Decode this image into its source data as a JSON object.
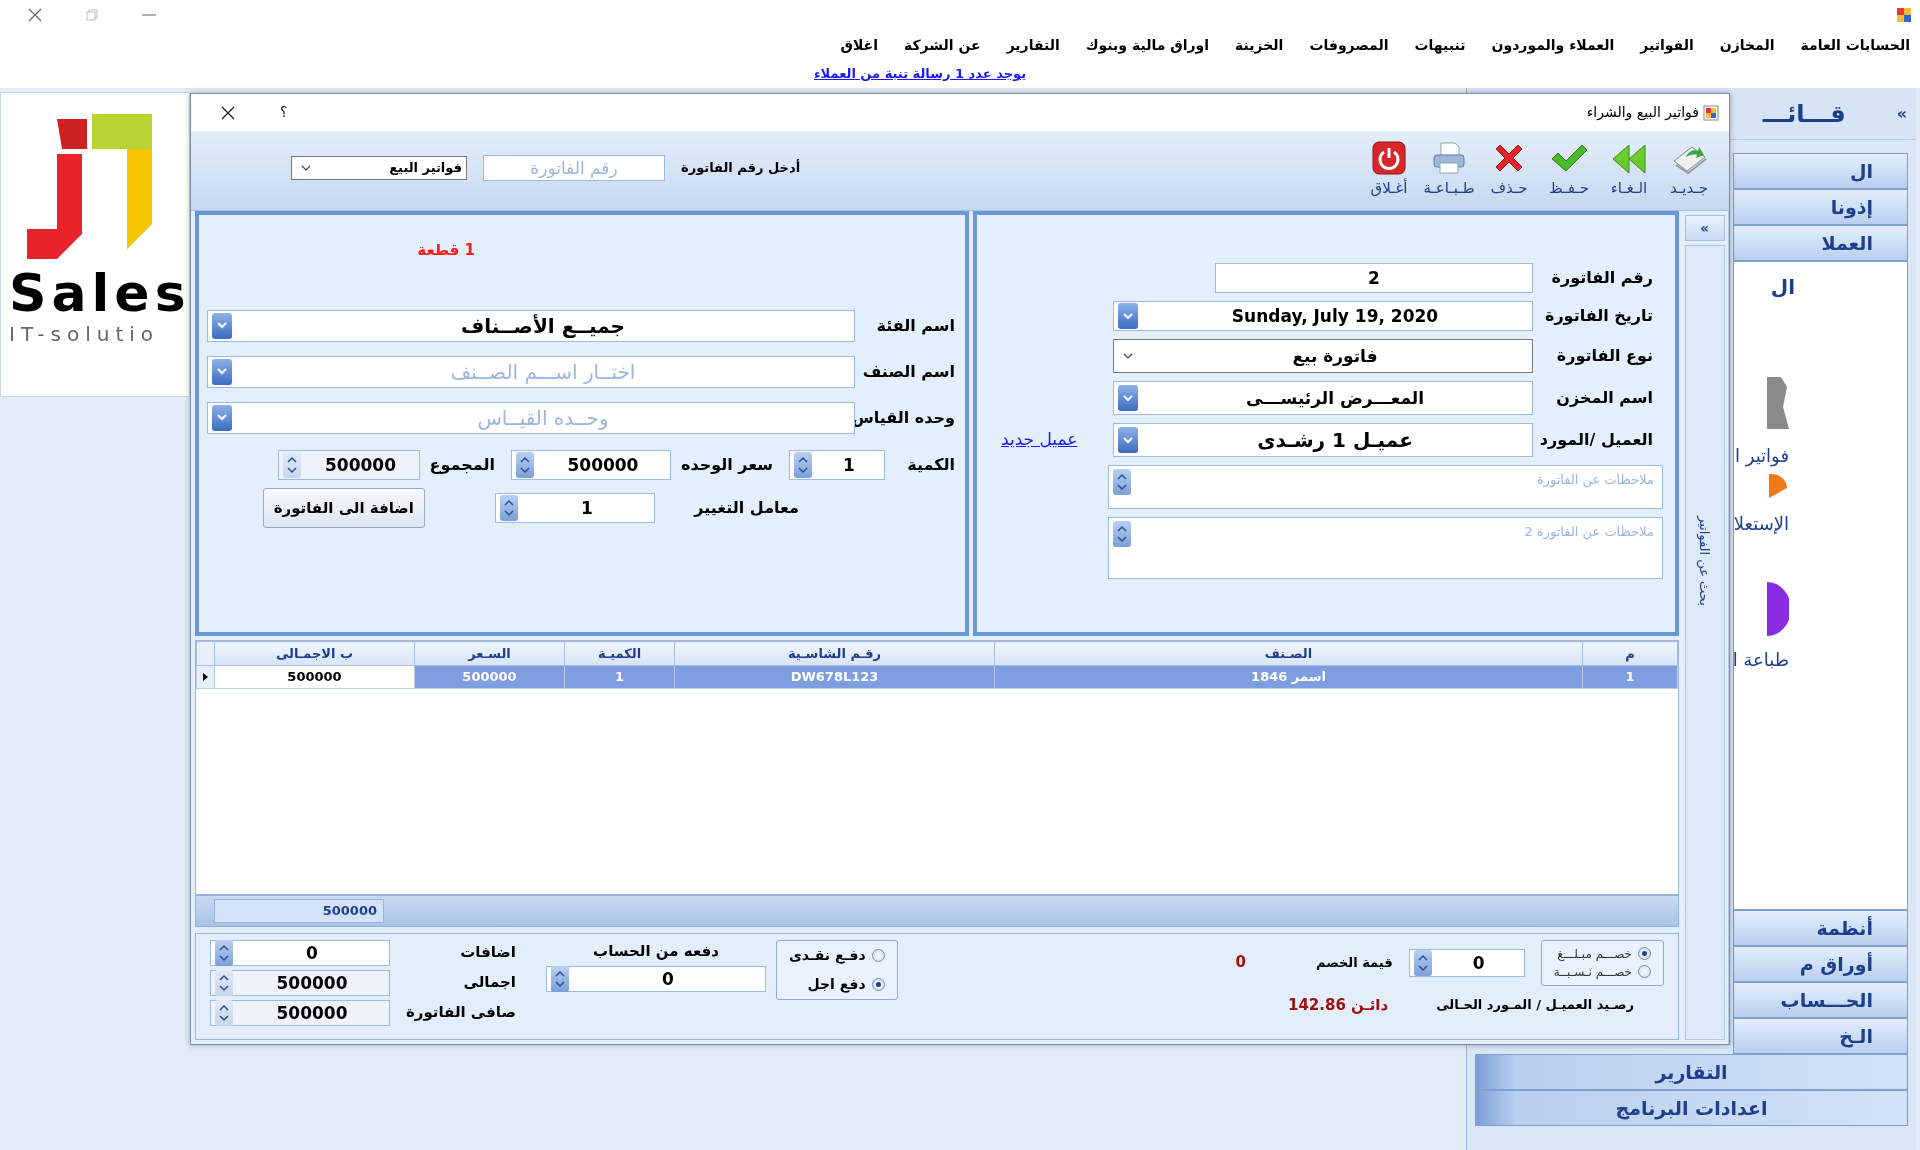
{
  "menu": [
    {
      "label": "الحسابات العامة"
    },
    {
      "label": "المخازن"
    },
    {
      "label": "الفواتير"
    },
    {
      "label": "العملاء والموردون"
    },
    {
      "label": "تنبيهات"
    },
    {
      "label": "المصروفات"
    },
    {
      "label": "الخزينة"
    },
    {
      "label": "اوراق مالية وبنوك"
    },
    {
      "label": "التقارير"
    },
    {
      "label": "عن الشركة"
    },
    {
      "label": "اغلاق"
    }
  ],
  "notice_link": "يوجد عدد 1 رسالة تنبة من العملاء",
  "logo": {
    "name": "Sales",
    "tagline": "IT-solutio"
  },
  "sidebar": {
    "title": "قـــائـــ",
    "collapse": "»",
    "sections_top": [
      "ال",
      "إذونا",
      "العملا"
    ],
    "panel_items": [
      {
        "kind": "header",
        "label": "ال"
      },
      {
        "kind": "figure",
        "label": "فواتير ا"
      },
      {
        "kind": "half-disc",
        "label": "الإستعلا"
      },
      {
        "kind": "disc",
        "label": "طباعة ا"
      }
    ],
    "sections_bottom": [
      "أنظمة",
      "أوراق م",
      "الحـــساب",
      "الـخ",
      "التقارير",
      "اعدادات البرنامج"
    ]
  },
  "dialog": {
    "title": "فواتير البيع والشراء",
    "help": "؟",
    "toolbar": [
      {
        "kind": "new",
        "label": "جـديـد"
      },
      {
        "kind": "cancel",
        "label": "الـغـاء"
      },
      {
        "kind": "save",
        "label": "حـفـظ"
      },
      {
        "kind": "delete",
        "label": "حـذف"
      },
      {
        "kind": "print",
        "label": "طـبـاعـة"
      },
      {
        "kind": "close",
        "label": "أغـلاق"
      }
    ],
    "invoice_lookup": {
      "label": "أدخل رقم الفاتورة",
      "placeholder": "رقم الفاتورة",
      "type_value": "فواتير البيع"
    },
    "invoice_panel": {
      "fields": [
        {
          "kind": "text",
          "label": "رقم الفاتورة",
          "value": "2"
        },
        {
          "kind": "combo",
          "label": "تاريخ الفاتورة",
          "value": "Sunday, July 19, 2020"
        },
        {
          "kind": "select",
          "label": "نوع الفاتورة",
          "value": "فاتورة بيع"
        },
        {
          "kind": "combo",
          "label": "اسم المخزن",
          "value": "المعـــرض الرئيســـى"
        },
        {
          "kind": "combo",
          "label": "العميل /المورد",
          "value": "عميـل 1 رشـدى",
          "link": "عميل جديد"
        }
      ],
      "notes": [
        {
          "placeholder": "ملاحظات عن الفاتورة"
        },
        {
          "placeholder": "ملاحظات عن الفاتورة 2"
        }
      ]
    },
    "item_panel": {
      "stock_note": "1 قطعة",
      "fields": [
        {
          "label": "اسم الفئة",
          "value": "جميــع الأصــناف"
        },
        {
          "label": "اسم الصنف",
          "placeholder": "اختــار اســـم الصــنف"
        },
        {
          "label": "وحده القياس",
          "placeholder": "وحــده القيــاس"
        }
      ],
      "quantity": {
        "label": "الكمية",
        "value": "1"
      },
      "unit_price": {
        "label": "سعر الوحده",
        "value": "500000"
      },
      "total": {
        "label": "المجموع",
        "value": "500000",
        "disabled": true
      },
      "factor": {
        "label": "معامل التغيير",
        "value": "1"
      },
      "add_button": "اضافة الى الفاتورة"
    },
    "lines_table": {
      "columns": [
        "م",
        "الصـنف",
        "رقـم الشاسـية",
        "الكميـة",
        "السـعر",
        "ب الاجمـالى"
      ],
      "rows": [
        {
          "cells": [
            "1",
            "اسمر 1846",
            "DW678L123",
            "1",
            "500000",
            "500000"
          ],
          "selected": true
        }
      ],
      "footer_total": "500000"
    },
    "totals": {
      "discount_modes": [
        {
          "label": "خصـــم مبـلـــغ",
          "selected": true
        },
        {
          "label": "خصـــم نـسـبــة",
          "selected": false
        }
      ],
      "discount_label": "قيمة الخصم",
      "discount_value": "0",
      "discount_amount": "0",
      "balance_label": "رصـيد العميـل / المـورد الحـالى",
      "balance_value": "دائـن 142.86",
      "payment_modes": [
        {
          "label": "دفـع نقـدى",
          "selected": false
        },
        {
          "label": "دفع اجل",
          "selected": true
        }
      ],
      "paid_label": "دفعه من الحساب",
      "paid_value": "0",
      "summary": [
        {
          "label": "اضافات",
          "value": "0",
          "disabled": false
        },
        {
          "label": "اجمالى",
          "value": "500000",
          "disabled": true
        },
        {
          "label": "صافى الفاتورة",
          "value": "500000",
          "disabled": true
        }
      ]
    },
    "search_strip": {
      "collapse": "»",
      "label": "بحث عن الفواتير"
    }
  }
}
